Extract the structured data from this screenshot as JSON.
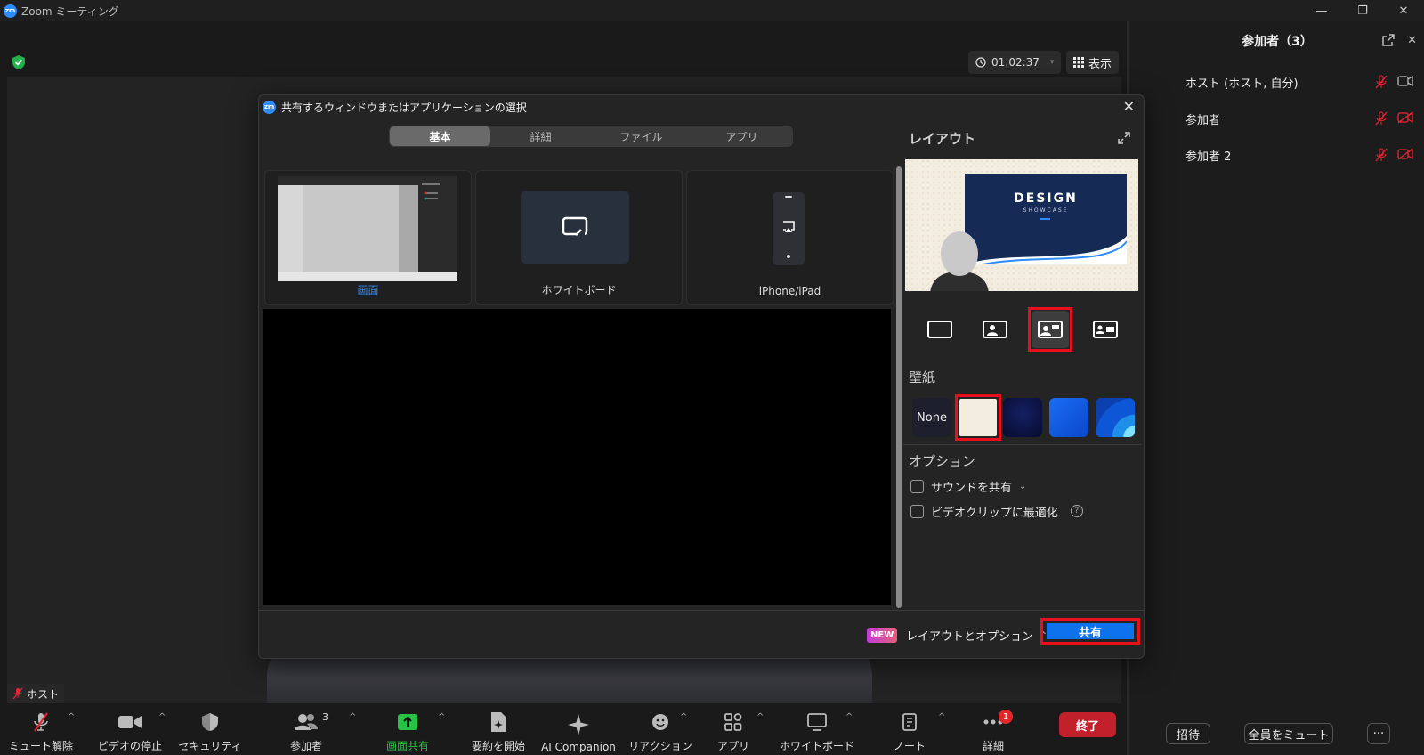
{
  "window": {
    "title": "Zoom ミーティング",
    "minimize": "—",
    "restore": "❐",
    "close": "✕"
  },
  "meeting": {
    "timer": "01:02:37",
    "view_label": "表示",
    "name_tag": "ホスト"
  },
  "toolbar": {
    "items": [
      {
        "label": "ミュート解除"
      },
      {
        "label": "ビデオの停止"
      },
      {
        "label": "セキュリティ"
      },
      {
        "label": "参加者",
        "count": "3"
      },
      {
        "label": "画面共有"
      },
      {
        "label": "要約を開始"
      },
      {
        "label": "AI Companion"
      },
      {
        "label": "リアクション"
      },
      {
        "label": "アプリ"
      },
      {
        "label": "ホワイトボード"
      },
      {
        "label": "ノート"
      },
      {
        "label": "詳細",
        "badge": "1"
      }
    ],
    "end_label": "終了"
  },
  "participants_panel": {
    "title": "参加者（3）",
    "rows": [
      {
        "name": "ホスト (ホスト, 自分)"
      },
      {
        "name": "参加者"
      },
      {
        "name": "参加者 2"
      }
    ],
    "invite_label": "招待",
    "mute_all_label": "全員をミュート",
    "more_label": "···"
  },
  "dialog": {
    "title": "共有するウィンドウまたはアプリケーションの選択",
    "tabs": [
      "基本",
      "詳細",
      "ファイル",
      "アプリ"
    ],
    "tiles": [
      {
        "label": "画面"
      },
      {
        "label": "ホワイトボード"
      },
      {
        "label": "iPhone/iPad"
      }
    ],
    "layout_heading": "レイアウト",
    "slide_title": "DESIGN",
    "slide_subtitle": "SHOWCASE",
    "wallpaper_heading": "壁紙",
    "wallpaper_none": "None",
    "options_heading": "オプション",
    "option_sound": "サウンドを共有",
    "option_video": "ビデオクリップに最適化",
    "help_glyph": "?",
    "new_badge": "NEW",
    "layout_options_link": "レイアウトとオプション",
    "share_label": "共有"
  },
  "colors": {
    "accent_blue": "#0e72ed",
    "end_red": "#c2202a",
    "highlight_red": "#e8101e",
    "share_green": "#27c346"
  }
}
